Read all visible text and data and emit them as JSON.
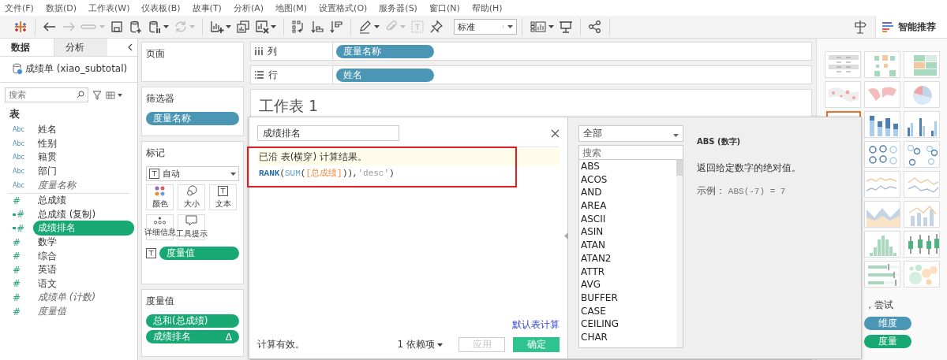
{
  "menu": [
    "文件(F)",
    "数据(D)",
    "工作表(W)",
    "仪表板(B)",
    "故事(T)",
    "分析(A)",
    "地图(M)",
    "设置格式(O)",
    "服务器(S)",
    "窗口(N)",
    "帮助(H)"
  ],
  "toolbar": {
    "groups": [
      [
        {
          "kind": "logo",
          "disabled": false,
          "caret": false
        }
      ],
      [
        {
          "kind": "back",
          "disabled": false,
          "caret": false
        },
        {
          "kind": "forward",
          "disabled": true,
          "caret": false
        },
        {
          "kind": "redo",
          "disabled": true,
          "caret": true
        },
        {
          "kind": "save",
          "disabled": false,
          "caret": false
        },
        {
          "kind": "datasource-new",
          "disabled": false,
          "caret": false
        },
        {
          "kind": "datasource-pause",
          "disabled": false,
          "caret": true
        },
        {
          "kind": "refresh",
          "disabled": true,
          "caret": true
        }
      ],
      [
        {
          "kind": "new-sheet",
          "disabled": false,
          "caret": true
        },
        {
          "kind": "duplicate",
          "disabled": false,
          "caret": false
        },
        {
          "kind": "clear",
          "disabled": false,
          "caret": true
        }
      ],
      [
        {
          "kind": "swap",
          "disabled": false,
          "caret": false
        },
        {
          "kind": "sort-asc",
          "disabled": false,
          "caret": false
        },
        {
          "kind": "sort-desc",
          "disabled": false,
          "caret": false
        }
      ],
      [
        {
          "kind": "highlight",
          "disabled": false,
          "caret": true
        },
        {
          "kind": "attach",
          "disabled": true,
          "caret": true
        },
        {
          "kind": "textbox",
          "disabled": true,
          "caret": false
        },
        {
          "kind": "pin",
          "disabled": false,
          "caret": false
        },
        {
          "kind": "fit",
          "label": "标准",
          "caret": true
        }
      ],
      [
        {
          "kind": "show-cards",
          "disabled": false,
          "caret": true
        },
        {
          "kind": "present",
          "disabled": false,
          "caret": false
        }
      ],
      [
        {
          "kind": "share",
          "disabled": false,
          "caret": false
        }
      ]
    ],
    "smart_tab": "智能推荐"
  },
  "data_pane": {
    "tabs": [
      {
        "label": "数据",
        "selected": true
      },
      {
        "label": "分析",
        "selected": false
      }
    ],
    "datasource": "成绩单 (xiao_subtotal)",
    "search": {
      "placeholder": "搜索"
    },
    "section": "表",
    "fields": [
      {
        "icon": "Abc",
        "label": "姓名",
        "kind": "dimension",
        "generated": false,
        "selected": false
      },
      {
        "icon": "Abc",
        "label": "性别",
        "kind": "dimension",
        "generated": false,
        "selected": false
      },
      {
        "icon": "Abc",
        "label": "籍贯",
        "kind": "dimension",
        "generated": false,
        "selected": false
      },
      {
        "icon": "Abc",
        "label": "部门",
        "kind": "dimension",
        "generated": false,
        "selected": false
      },
      {
        "icon": "Abc",
        "label": "度量名称",
        "kind": "dimension",
        "generated": true,
        "selected": false
      },
      {
        "icon": "#",
        "label": "总成绩",
        "kind": "measure",
        "generated": false,
        "selected": false
      },
      {
        "icon": "#",
        "label": "总成绩 (复制)",
        "kind": "calculated",
        "generated": false,
        "selected": false
      },
      {
        "icon": "#",
        "label": "成绩排名",
        "kind": "calculated",
        "generated": false,
        "selected": true
      },
      {
        "icon": "#",
        "label": "数学",
        "kind": "measure",
        "generated": false,
        "selected": false
      },
      {
        "icon": "#",
        "label": "综合",
        "kind": "measure",
        "generated": false,
        "selected": false
      },
      {
        "icon": "#",
        "label": "英语",
        "kind": "measure",
        "generated": false,
        "selected": false
      },
      {
        "icon": "#",
        "label": "语文",
        "kind": "measure",
        "generated": false,
        "selected": false
      },
      {
        "icon": "#",
        "label": "成绩单 (计数)",
        "kind": "measure",
        "generated": true,
        "selected": false
      },
      {
        "icon": "#",
        "label": "度量值",
        "kind": "measure",
        "generated": true,
        "selected": false
      }
    ]
  },
  "cards": {
    "pages": {
      "title": "页面"
    },
    "filters": {
      "title": "筛选器",
      "pills": [
        {
          "label": "度量名称",
          "kind": "dimension"
        }
      ]
    },
    "marks": {
      "title": "标记",
      "type": "自动",
      "buttons": [
        {
          "label": "颜色",
          "kind": "color"
        },
        {
          "label": "大小",
          "kind": "size"
        },
        {
          "label": "文本",
          "kind": "text"
        },
        {
          "label": "详细信息",
          "kind": "detail"
        },
        {
          "label": "工具提示",
          "kind": "tooltip"
        }
      ],
      "pills": [
        {
          "label": "度量值",
          "kind": "measure"
        }
      ]
    },
    "measure_values": {
      "title": "度量值",
      "pills": [
        {
          "label": "总和(总成绩)",
          "kind": "measure"
        },
        {
          "label": "成绩排名",
          "kind": "measure",
          "flag": "Δ"
        }
      ]
    }
  },
  "columns_shelf": {
    "label": "列",
    "pills": [
      {
        "label": "度量名称",
        "kind": "dimension"
      }
    ]
  },
  "rows_shelf": {
    "label": "行",
    "pills": [
      {
        "label": "姓名",
        "kind": "dimension"
      }
    ]
  },
  "sheet": {
    "title": "工作表 1"
  },
  "show_me": {
    "rows": [
      {
        "charts": [
          {
            "kind": "text-table",
            "selected": false
          },
          {
            "kind": "heat-map",
            "selected": false
          },
          {
            "kind": "highlight-table",
            "selected": false
          }
        ]
      },
      {
        "charts": [
          {
            "kind": "symbol-map",
            "selected": false
          },
          {
            "kind": "filled-map",
            "selected": false
          },
          {
            "kind": "pie",
            "selected": false
          }
        ]
      },
      {
        "charts": [
          {
            "kind": "bar",
            "selected": true
          },
          {
            "kind": "stacked-bar",
            "selected": false
          },
          {
            "kind": "side-bar",
            "selected": false
          }
        ]
      },
      {
        "charts": [
          {
            "kind": "circles",
            "selected": false
          },
          {
            "kind": "side-circles",
            "selected": false
          }
        ]
      },
      {
        "charts": [
          {
            "kind": "dual-line",
            "selected": false
          },
          {
            "kind": "line",
            "selected": false
          }
        ]
      },
      {
        "charts": [
          {
            "kind": "area",
            "selected": false
          },
          {
            "kind": "combo",
            "selected": false
          }
        ]
      },
      {
        "charts": [
          {
            "kind": "histogram",
            "selected": false
          },
          {
            "kind": "box-plot",
            "selected": false
          }
        ]
      },
      {
        "charts": [
          {
            "kind": "bullet",
            "selected": false
          },
          {
            "kind": "bubbles",
            "selected": false
          }
        ]
      }
    ],
    "hint": "，尝试",
    "pills": [
      {
        "label": "维度",
        "kind": "dimension"
      },
      {
        "label": "度量",
        "kind": "measure"
      }
    ]
  },
  "calc_dialog": {
    "name": "成绩排名",
    "hint": "已沿 表(横穿) 计算结果。",
    "formula": [
      {
        "text": "RANK",
        "kind": "function"
      },
      {
        "text": "(",
        "kind": "punct"
      },
      {
        "text": "SUM",
        "kind": "aggregate"
      },
      {
        "text": "(",
        "kind": "punct"
      },
      {
        "text": "[总成绩]",
        "kind": "field"
      },
      {
        "text": ")",
        "kind": "punct"
      },
      {
        "text": ")",
        "kind": "punct"
      },
      {
        "text": ",",
        "kind": "punct"
      },
      {
        "text": "'desc'",
        "kind": "string"
      },
      {
        "text": ")",
        "kind": "punct"
      }
    ],
    "default_link": "默认表计算",
    "status": "计算有效。",
    "dependencies": "1 依赖项",
    "apply": {
      "label": "应用",
      "disabled": true
    },
    "ok": {
      "label": "确定",
      "disabled": false
    },
    "category": "全部",
    "function_search": {
      "placeholder": "搜索"
    },
    "functions": [
      "ABS",
      "ACOS",
      "AND",
      "AREA",
      "ASCII",
      "ASIN",
      "ATAN",
      "ATAN2",
      "ATTR",
      "AVG",
      "BUFFER",
      "CASE",
      "CEILING",
      "CHAR"
    ],
    "help": {
      "title": "ABS (数字)",
      "description": "返回给定数字的绝对值。",
      "example_label": "示例：",
      "example": "ABS(-7) = 7"
    }
  }
}
